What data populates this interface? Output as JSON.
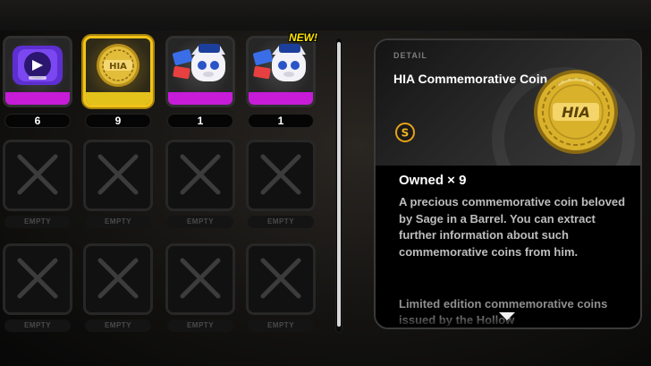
{
  "grid": {
    "items": [
      {
        "name": "Purple Gadget",
        "count": "6",
        "state": "filled"
      },
      {
        "name": "HIA Commemorative Coin",
        "count": "9",
        "state": "selected"
      },
      {
        "name": "Bangboo Police Sticker",
        "count": "1",
        "state": "filled"
      },
      {
        "name": "Bangboo Police Sticker",
        "count": "1",
        "state": "filled",
        "badge": "NEW!"
      }
    ],
    "empty_label": "EMPTY"
  },
  "detail": {
    "label": "DETAIL",
    "title": "HIA Commemorative Coin",
    "rank": "S",
    "owned": "Owned × 9",
    "description": "A precious commemorative coin beloved by Sage in a Barrel. You can extract further information about such commemorative coins from him.",
    "description_more": "Limited edition commemorative coins issued by the Hollow",
    "coin_text": "HIA"
  },
  "colors": {
    "rarity_strip": "#c61cd8",
    "selected_border": "#f0c419",
    "coin_gold": "#d9b12b"
  },
  "icons": {
    "empty_slot": "x-mark-icon",
    "rank": "s-rank-badge-icon",
    "scroll_more": "chevron-down-icon"
  }
}
